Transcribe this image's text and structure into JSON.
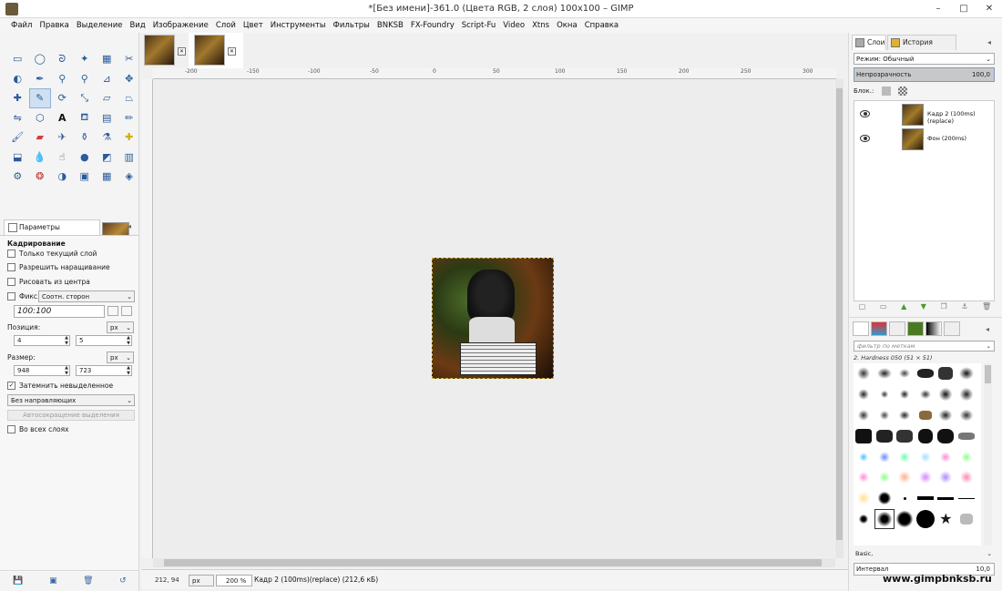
{
  "window": {
    "title": "*[Без имени]-361.0 (Цвета RGB, 2 слоя) 100x100 – GIMP",
    "minimize": "–",
    "maximize": "□",
    "close": "✕"
  },
  "menu": [
    "Файл",
    "Правка",
    "Выделение",
    "Вид",
    "Изображение",
    "Слой",
    "Цвет",
    "Инструменты",
    "Фильтры",
    "BNKSB",
    "FX-Foundry",
    "Script-Fu",
    "Video",
    "Xtns",
    "Окна",
    "Справка"
  ],
  "tool_options": {
    "tab_label": "Параметры инструментов",
    "section_title": "Кадрирование",
    "current_layer_only": "Только текущий слой",
    "allow_growing": "Разрешить наращивание",
    "draw_from_center": "Рисовать из центра",
    "fixed_label": "Фикс.:",
    "fixed_value": "Соотн. сторон",
    "ratio_value": "100:100",
    "position_label": "Позиция:",
    "position_unit": "px",
    "pos_x": "4",
    "pos_y": "5",
    "size_label": "Размер:",
    "size_unit": "px",
    "size_w": "948",
    "size_h": "723",
    "highlight": "Затемнить невыделенное",
    "guides": "Без направляющих",
    "auto_shrink": "Автосокращение выделения",
    "all_layers": "Во всех слоях"
  },
  "rulers": {
    "horizontal": [
      "-200",
      "-150",
      "-100",
      "-50",
      "0",
      "50",
      "100",
      "150",
      "200",
      "250",
      "300"
    ]
  },
  "status": {
    "coords": "212, 94",
    "unit": "px",
    "zoom": "200 %",
    "message": "Кадр 2  (100ms)(replace) (212,6 кБ)"
  },
  "layers_panel": {
    "tab_layers": "Слои",
    "tab_history": "История действий",
    "mode_label": "Режим:",
    "mode_value": "Обычный",
    "opacity_label": "Непрозрачность",
    "opacity_value": "100,0",
    "lock_label": "Блок.:",
    "layers": [
      {
        "name": "Кадр 2  (100ms)(replace)"
      },
      {
        "name": "Фон (200ms)"
      }
    ]
  },
  "brushes_panel": {
    "filter_placeholder": "фильтр по меткам",
    "brush_name": "2. Hardness 050 (51 × 51)",
    "set_value": "Basic,",
    "interval_label": "Интервал",
    "interval_value": "10,0"
  },
  "watermark": "www.gimpbnksb.ru"
}
